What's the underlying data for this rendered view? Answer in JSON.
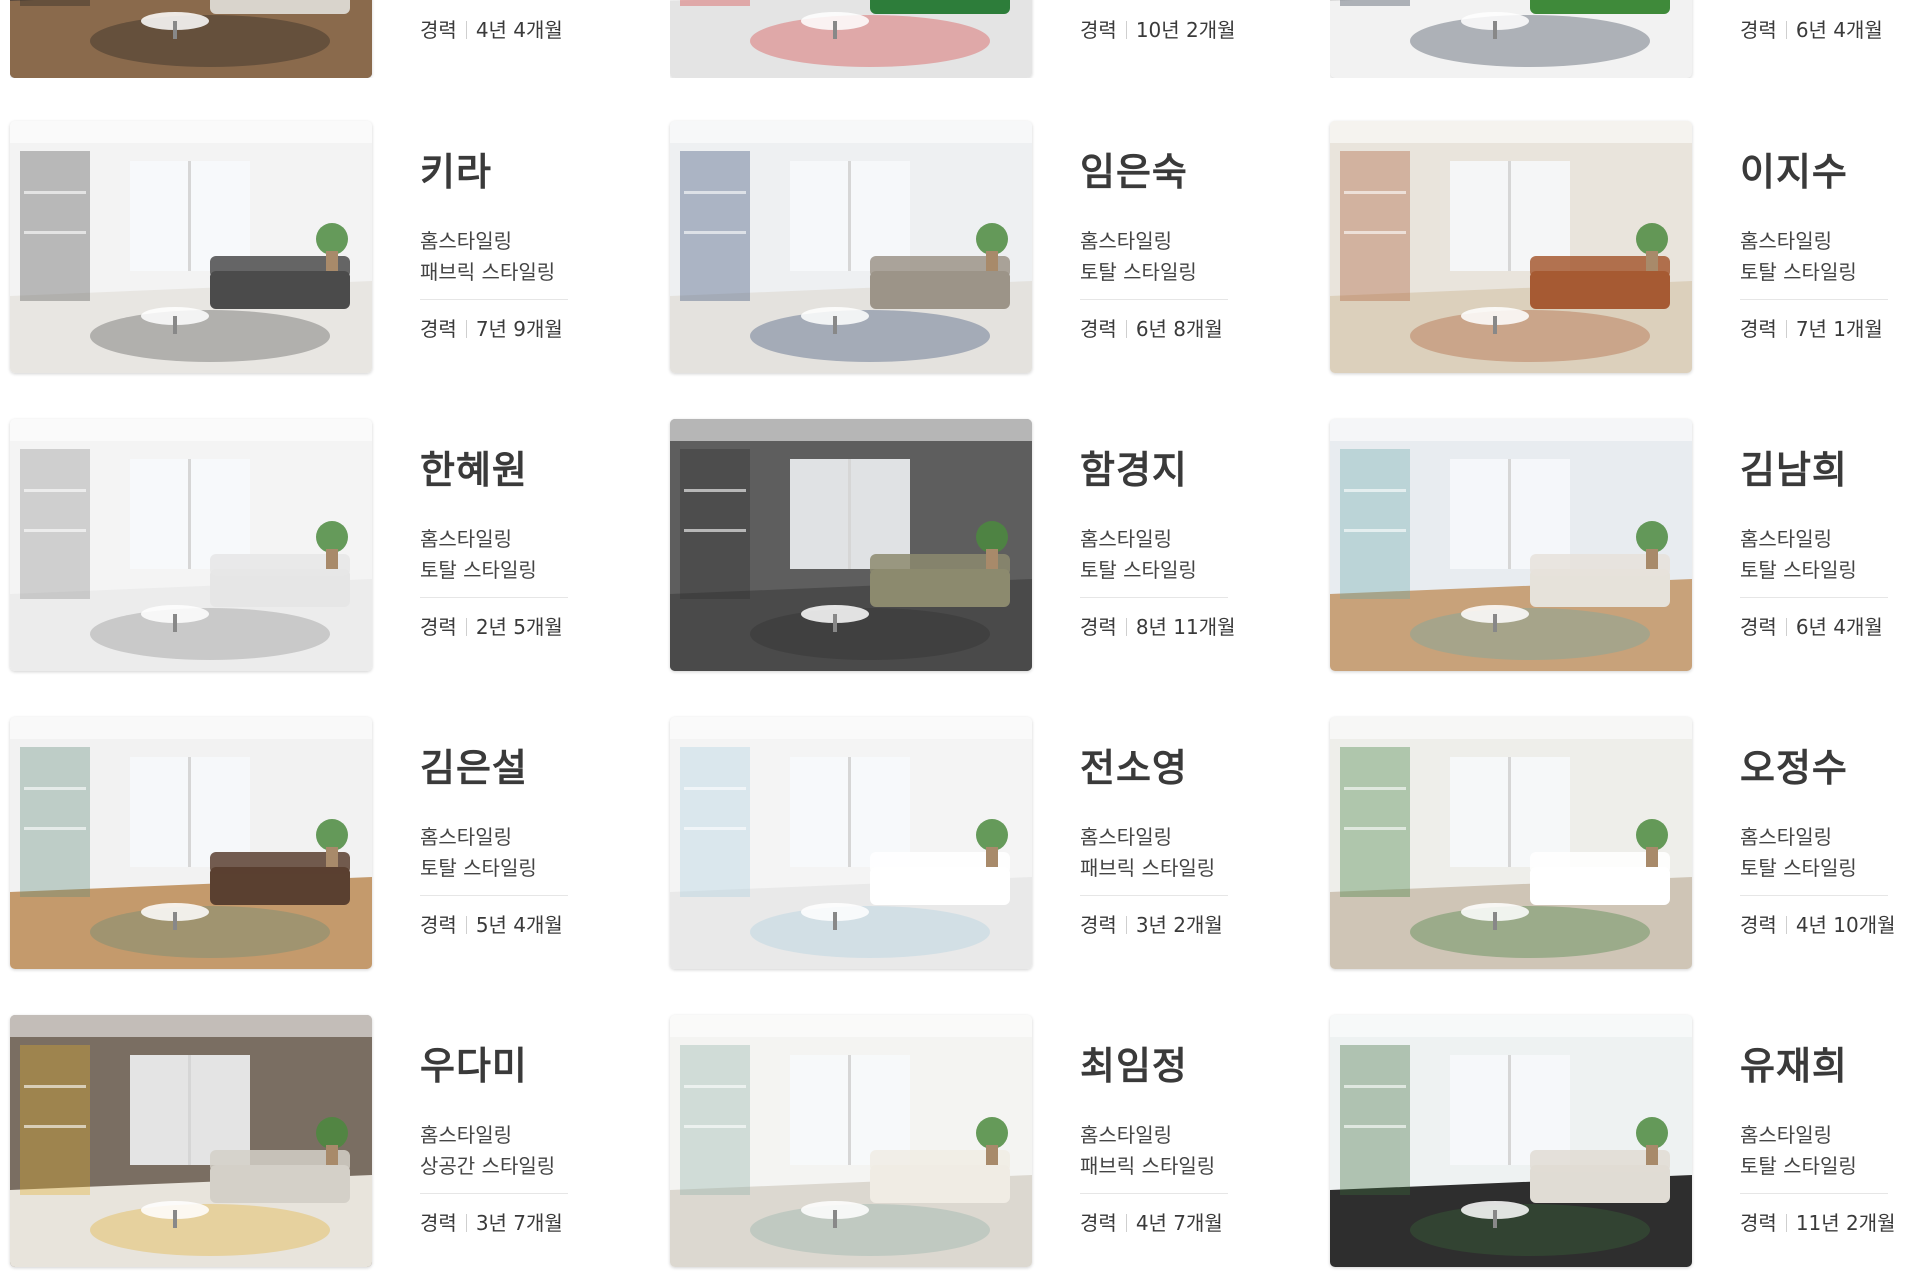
{
  "career_label": "경력",
  "designers": [
    {
      "name": "",
      "services": [],
      "career": "4년 4개월"
    },
    {
      "name": "",
      "services": [],
      "career": "10년 2개월"
    },
    {
      "name": "",
      "services": [],
      "career": "6년 4개월"
    },
    {
      "name": "키라",
      "services": [
        "홈스타일링",
        "패브릭 스타일링"
      ],
      "career": "7년 9개월"
    },
    {
      "name": "임은숙",
      "services": [
        "홈스타일링",
        "토탈 스타일링"
      ],
      "career": "6년 8개월"
    },
    {
      "name": "이지수",
      "services": [
        "홈스타일링",
        "토탈 스타일링"
      ],
      "career": "7년 1개월"
    },
    {
      "name": "한혜원",
      "services": [
        "홈스타일링",
        "토탈 스타일링"
      ],
      "career": "2년 5개월"
    },
    {
      "name": "함경지",
      "services": [
        "홈스타일링",
        "토탈 스타일링"
      ],
      "career": "8년 11개월"
    },
    {
      "name": "김남희",
      "services": [
        "홈스타일링",
        "토탈 스타일링"
      ],
      "career": "6년 4개월"
    },
    {
      "name": "김은설",
      "services": [
        "홈스타일링",
        "토탈 스타일링"
      ],
      "career": "5년 4개월"
    },
    {
      "name": "전소영",
      "services": [
        "홈스타일링",
        "패브릭 스타일링"
      ],
      "career": "3년 2개월"
    },
    {
      "name": "오정수",
      "services": [
        "홈스타일링",
        "토탈 스타일링"
      ],
      "career": "4년 10개월"
    },
    {
      "name": "우다미",
      "services": [
        "홈스타일링",
        "상공간 스타일링"
      ],
      "career": "3년 7개월"
    },
    {
      "name": "최임정",
      "services": [
        "홈스타일링",
        "패브릭 스타일링"
      ],
      "career": "4년 7개월"
    },
    {
      "name": "유재희",
      "services": [
        "홈스타일링",
        "토탈 스타일링"
      ],
      "career": "11년 2개월"
    }
  ],
  "photos": [
    {
      "scene": "bedroom",
      "wall": "#5a4a3e",
      "floor": "#8a6a4c",
      "accent": "#1f1f1f",
      "sofa": "#d9d4cc"
    },
    {
      "scene": "kids-playroom",
      "wall": "#eeeeee",
      "floor": "#e4e4e4",
      "accent": "#d83a3a",
      "sofa": "#2d7d3a"
    },
    {
      "scene": "entrance",
      "wall": "#d9d9d9",
      "floor": "#f2f2f2",
      "accent": "#2d3a4a",
      "sofa": "#3f8a3a"
    },
    {
      "scene": "living-room",
      "wall": "#f3f3f3",
      "floor": "#e8e6e2",
      "accent": "#4a4a4a",
      "sofa": "#4b4b4b"
    },
    {
      "scene": "living-room",
      "wall": "#eef0f2",
      "floor": "#e4e2de",
      "accent": "#2d4470",
      "sofa": "#9c9488"
    },
    {
      "scene": "living-room",
      "wall": "#e9e4dc",
      "floor": "#dcd0bc",
      "accent": "#a9552e",
      "sofa": "#a65a33"
    },
    {
      "scene": "dining",
      "wall": "#f4f4f4",
      "floor": "#ececec",
      "accent": "#8a8a8a",
      "sofa": "#e6e6e6"
    },
    {
      "scene": "living-room",
      "wall": "#5e5e5e",
      "floor": "#4a4a4a",
      "accent": "#2e2e2e",
      "sofa": "#8c8a6e"
    },
    {
      "scene": "living-room",
      "wall": "#e8ecf0",
      "floor": "#c8a27a",
      "accent": "#68a8a8",
      "sofa": "#e6e2da"
    },
    {
      "scene": "dining-library",
      "wall": "#f2f2f2",
      "floor": "#c49a6c",
      "accent": "#5e8a78",
      "sofa": "#5a4030"
    },
    {
      "scene": "kitchen",
      "wall": "#f4f4f4",
      "floor": "#e9e9e9",
      "accent": "#a9cde0",
      "sofa": "#ffffff"
    },
    {
      "scene": "cafe",
      "wall": "#eeeeea",
      "floor": "#cfc5b6",
      "accent": "#3a7a3a",
      "sofa": "#ffffff"
    },
    {
      "scene": "living-room",
      "wall": "#7a6e62",
      "floor": "#e8e4dc",
      "accent": "#e2b02a",
      "sofa": "#d4d0c8"
    },
    {
      "scene": "library-nook",
      "wall": "#f4f4f2",
      "floor": "#dcd8d0",
      "accent": "#8cb0a6",
      "sofa": "#f0ece4"
    },
    {
      "scene": "dining",
      "wall": "#eef2f2",
      "floor": "#2e2e2e",
      "accent": "#3a6a3a",
      "sofa": "#e0dcd4"
    }
  ]
}
